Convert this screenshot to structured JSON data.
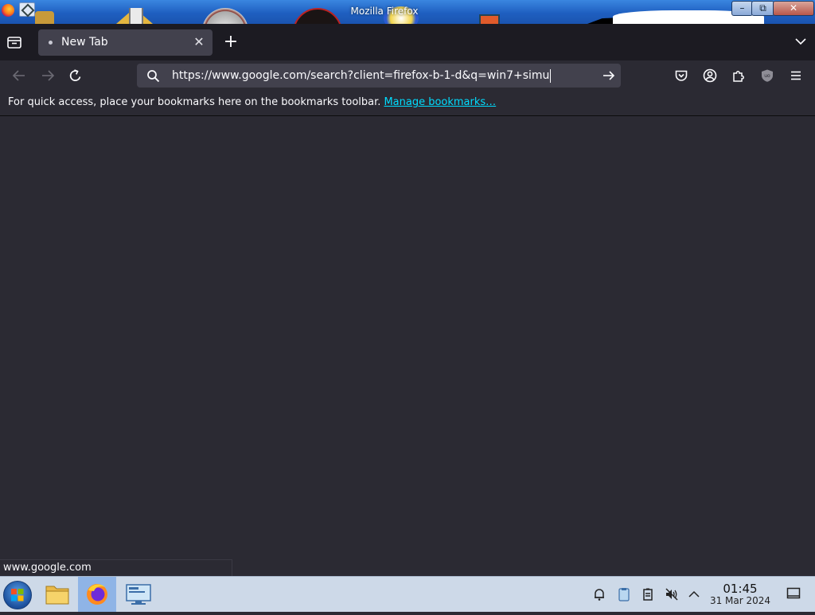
{
  "window": {
    "title": "Mozilla Firefox",
    "controls": {
      "minimize": "–",
      "maximize": "⧉",
      "close": "✕"
    }
  },
  "tabs": [
    {
      "title": "New Tab",
      "close": "✕",
      "active": true
    }
  ],
  "tabstrip": {
    "new_tab": "+"
  },
  "urlbar": {
    "value": "https://www.google.com/search?client=firefox-b-1-d&q=win7+simu"
  },
  "bookmarks_bar": {
    "text": "For quick access, place your bookmarks here on the bookmarks toolbar.",
    "link": "Manage bookmarks…"
  },
  "status": {
    "text": "www.google.com"
  },
  "taskbar": {
    "apps": [
      "file-manager-icon",
      "firefox-icon",
      "remote-desktop-icon"
    ],
    "clock": {
      "time": "01:45",
      "date": "31 Mar 2024"
    }
  },
  "icons": {
    "toolbar": [
      "back-icon",
      "forward-icon",
      "reload-icon",
      "pocket-icon",
      "account-icon",
      "extensions-icon",
      "ublock-icon",
      "hamburger-menu-icon"
    ]
  },
  "colors": {
    "chrome": "#2b2a33",
    "tabstrip": "#1c1b22",
    "active_tab": "#42414d",
    "link": "#00ddff",
    "taskbar": "#cdd9e8"
  }
}
